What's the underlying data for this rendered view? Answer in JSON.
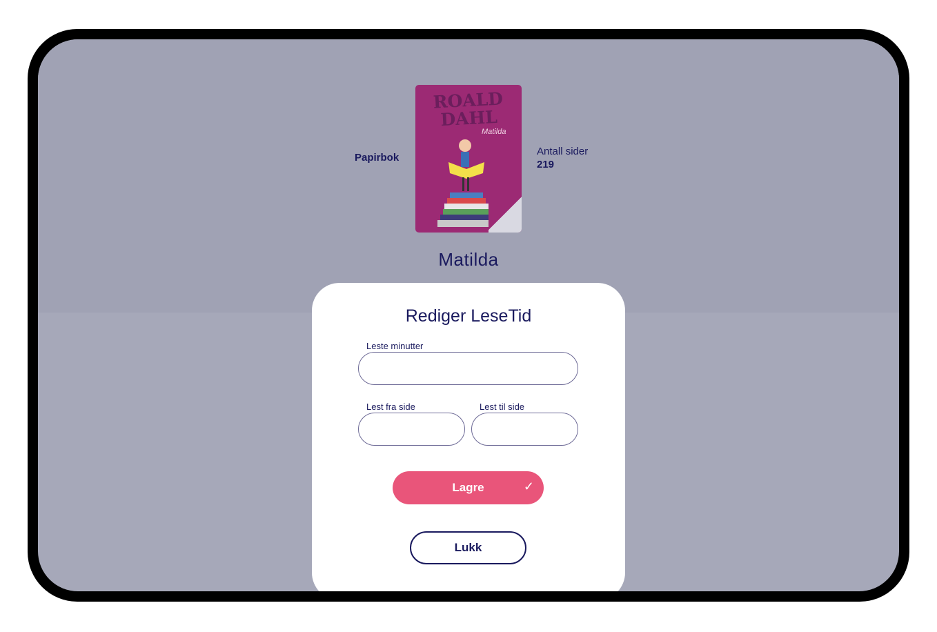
{
  "book": {
    "format": "Papirbok",
    "title": "Matilda",
    "pages_label": "Antall sider",
    "pages_value": "219",
    "cover": {
      "author": "ROALD DAHL",
      "title": "Matilda",
      "color": "#9c2a74"
    }
  },
  "modal": {
    "title": "Rediger LeseTid",
    "minutes_label": "Leste minutter",
    "minutes_value": "",
    "from_page_label": "Lest fra side",
    "from_page_value": "",
    "to_page_label": "Lest til side",
    "to_page_value": "",
    "save_label": "Lagre",
    "save_icon": "check-icon",
    "close_label": "Lukk"
  },
  "colors": {
    "primary_text": "#1a1a5e",
    "accent": "#e9557a",
    "overlay": "#a6a8b9"
  }
}
